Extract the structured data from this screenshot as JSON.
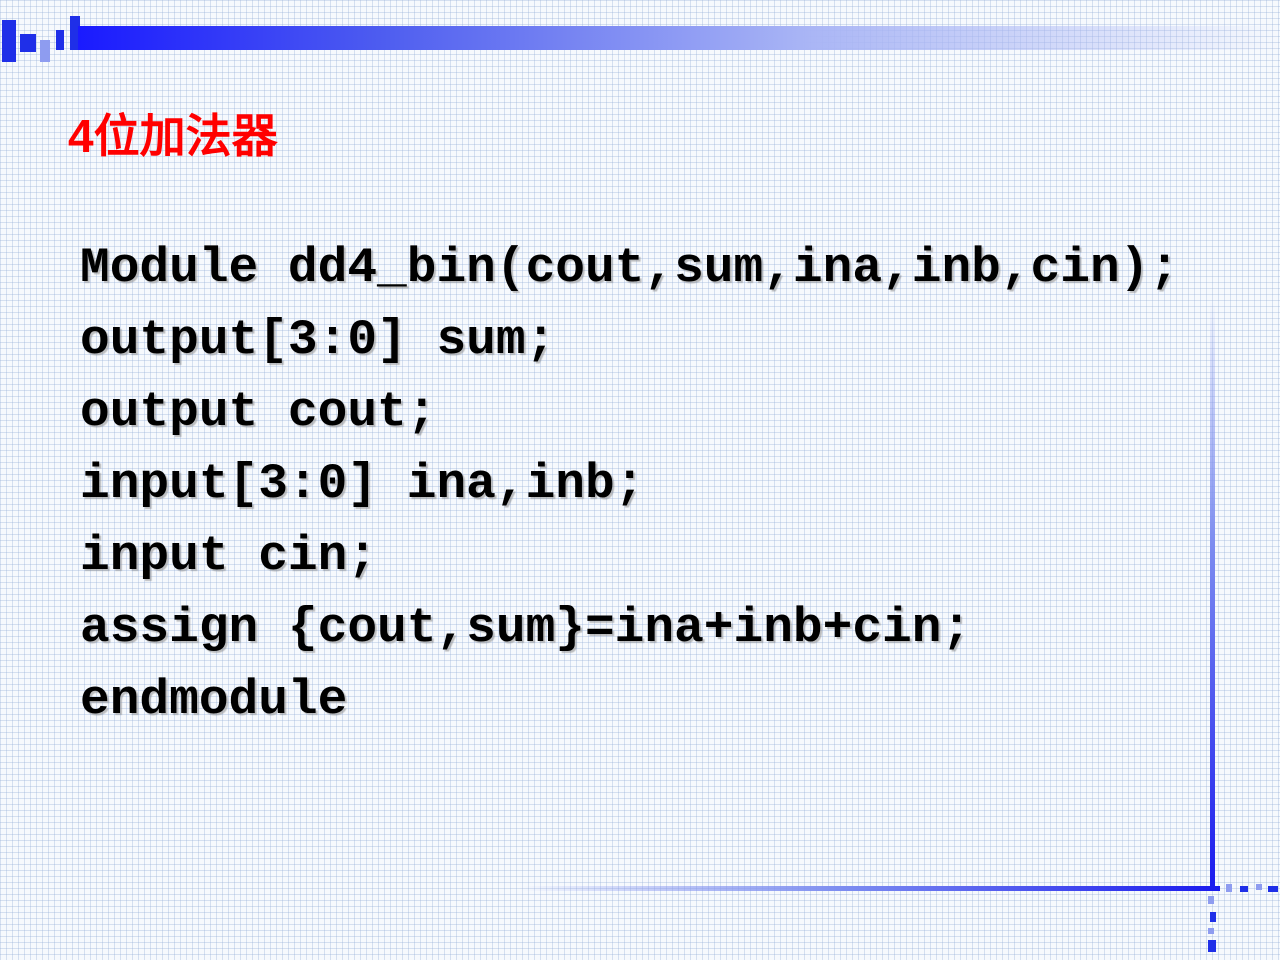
{
  "slide": {
    "title": "4位加法器",
    "code_lines": [
      "Module dd4_bin(cout,sum,ina,inb,cin);",
      "output[3:0] sum;",
      "output cout;",
      "input[3:0] ina,inb;",
      "input cin;",
      "assign {cout,sum}=ina+inb+cin;",
      "endmodule"
    ]
  },
  "colors": {
    "title": "#ff0000",
    "text": "#000000",
    "accent": "#1a1aff",
    "background": "#f6f9fd"
  }
}
